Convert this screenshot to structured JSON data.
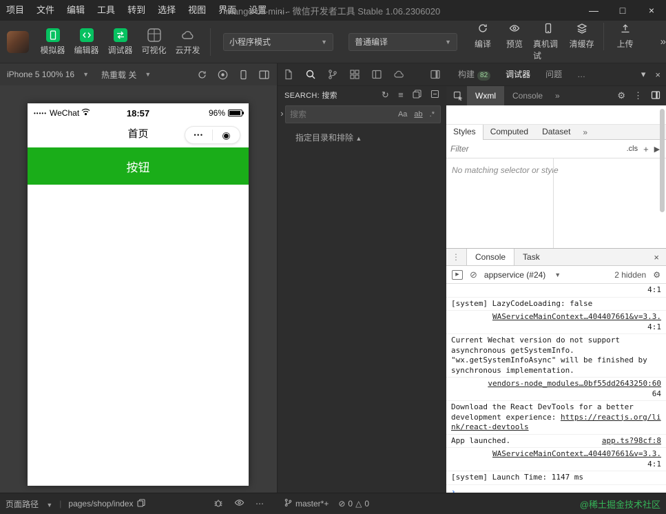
{
  "colors": {
    "wechat_green": "#07c160",
    "button_green": "#1aad19",
    "watermark_green": "#35b558"
  },
  "menubar": {
    "items": [
      "项目",
      "文件",
      "编辑",
      "工具",
      "转到",
      "选择",
      "视图",
      "界面",
      "设置",
      "…"
    ],
    "title": "mango-oil-mini - 微信开发者工具 Stable 1.06.2306020",
    "window": {
      "minimize": "—",
      "maximize": "□",
      "close": "×"
    }
  },
  "toolbar": {
    "nav_buttons": [
      {
        "label": "模拟器"
      },
      {
        "label": "编辑器"
      },
      {
        "label": "调试器"
      },
      {
        "label": "可视化"
      },
      {
        "label": "云开发"
      }
    ],
    "mode_select": "小程序模式",
    "compile_select": "普通编译",
    "action_buttons": [
      {
        "label": "编译"
      },
      {
        "label": "预览"
      },
      {
        "label": "真机调试"
      },
      {
        "label": "清缓存"
      },
      {
        "label": "上传"
      }
    ],
    "overflow": "»"
  },
  "simulator": {
    "device_select": "iPhone 5 100% 16",
    "hot_reload_select": "热重载 关",
    "phone": {
      "signal_dots": "•••••",
      "carrier": "WeChat",
      "time": "18:57",
      "battery_percent": "96%",
      "nav_title": "首页",
      "more_dots": "•••",
      "home_glyph": "◉",
      "button_label": "按钮"
    }
  },
  "explorer": {
    "search_title": "SEARCH: 搜索",
    "search_placeholder": "搜索",
    "match_case": "Aa",
    "whole_word": "ab",
    "regex": ".*",
    "dir_option": "指定目录和排除"
  },
  "devtools": {
    "tabs": [
      {
        "label": "构建",
        "badge": "82"
      },
      {
        "label": "调试器"
      },
      {
        "label": "问题"
      },
      {
        "label": "…"
      }
    ],
    "panel_tabs": [
      "Wxml",
      "Console",
      "»"
    ],
    "style_tabs": [
      "Styles",
      "Computed",
      "Dataset",
      "»"
    ],
    "filter_placeholder": "Filter",
    "cls_button": ".cls",
    "add_button": "+",
    "empty_message": "No matching selector or style"
  },
  "console": {
    "tabs": [
      "Console",
      "Task"
    ],
    "context_select": "appservice (#24)",
    "hidden_label": "2 hidden",
    "messages": [
      {
        "text": "",
        "loc": "4:1"
      },
      {
        "text": "[system] LazyCodeLoading: false"
      },
      {
        "link": "WAServiceMainContext…404407661&v=3.3.",
        "loc": "4:1"
      },
      {
        "text": "Current Wechat version do not support asynchronous getSystemInfo. \"wx.getSystemInfoAsync\" will be finished by synchronous implementation."
      },
      {
        "link": "vendors-node_modules…0bf55dd2643250:60",
        "loc": "64"
      },
      {
        "text": "Download the React DevTools for a better development experience: ",
        "link": "https://reactjs.org/link/react-devtools"
      },
      {
        "text": "App launched.",
        "link": "app.ts?98cf:8"
      },
      {
        "link": "WAServiceMainContext…404407661&v=3.3.",
        "loc": "4:1"
      },
      {
        "text": "[system] Launch Time: 1147 ms"
      }
    ]
  },
  "statusbar": {
    "page_path_label": "页面路径",
    "page_path": "pages/shop/index",
    "branch": "master*+",
    "error_count": "0",
    "warning_count": "0",
    "watermark": "@稀土掘金技术社区"
  }
}
